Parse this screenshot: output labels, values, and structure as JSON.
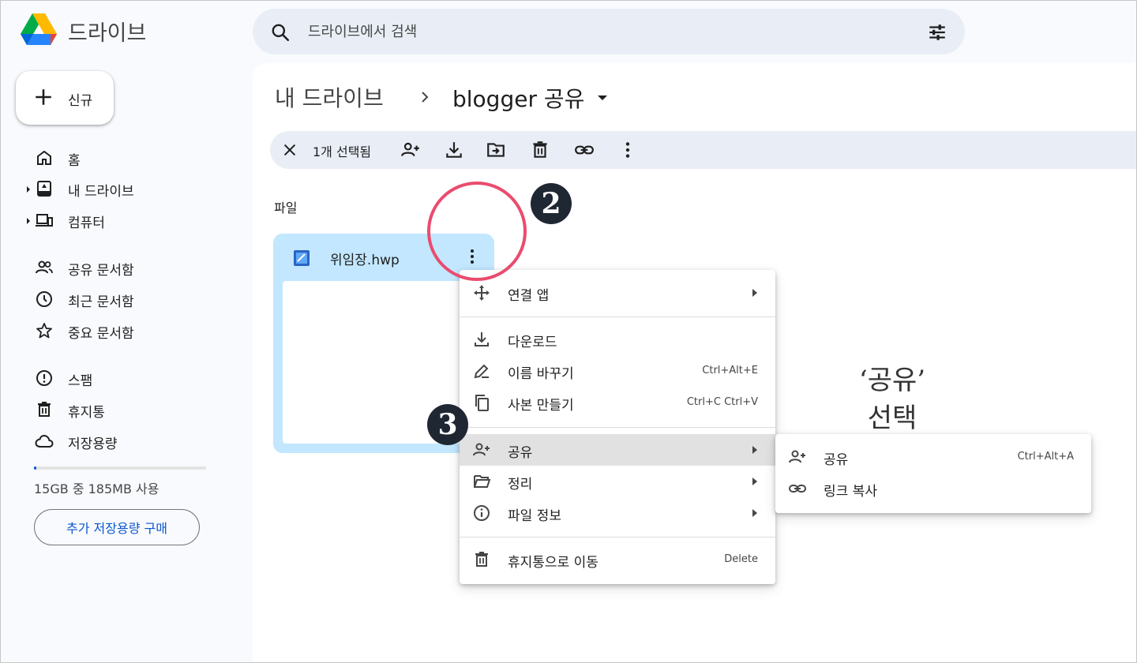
{
  "app": {
    "title": "드라이브"
  },
  "search": {
    "placeholder": "드라이브에서 검색"
  },
  "sidebar": {
    "new_label": "신규",
    "items": [
      {
        "label": "홈",
        "icon": "home-icon"
      },
      {
        "label": "내 드라이브",
        "icon": "my-drive-icon"
      },
      {
        "label": "컴퓨터",
        "icon": "computer-icon"
      },
      {
        "label": "공유 문서함",
        "icon": "shared-icon"
      },
      {
        "label": "최근 문서함",
        "icon": "clock-icon"
      },
      {
        "label": "중요 문서함",
        "icon": "star-icon"
      },
      {
        "label": "스팸",
        "icon": "spam-icon"
      },
      {
        "label": "휴지통",
        "icon": "trash-icon"
      },
      {
        "label": "저장용량",
        "icon": "cloud-icon"
      }
    ],
    "storage_text": "15GB 중 185MB 사용",
    "storage_used_fraction": 0.012,
    "buy_label": "추가 저장용량 구매"
  },
  "breadcrumb": {
    "root": "내 드라이브",
    "current": "blogger 공유"
  },
  "selection": {
    "count_label": "1개 선택됨"
  },
  "files": {
    "section_label": "파일",
    "items": [
      {
        "name": "위임장.hwp"
      }
    ]
  },
  "context_menu": {
    "items": [
      {
        "label": "연결 앱",
        "icon": "open-with-icon"
      },
      {
        "label": "다운로드",
        "icon": "download-icon"
      },
      {
        "label": "이름 바꾸기",
        "icon": "rename-icon",
        "shortcut": "Ctrl+Alt+E"
      },
      {
        "label": "사본 만들기",
        "icon": "copy-icon",
        "shortcut": "Ctrl+C Ctrl+V"
      },
      {
        "label": "공유",
        "icon": "share-icon"
      },
      {
        "label": "정리",
        "icon": "folder-open-icon"
      },
      {
        "label": "파일 정보",
        "icon": "info-icon"
      },
      {
        "label": "휴지통으로 이동",
        "icon": "trash-icon",
        "shortcut": "Delete"
      }
    ]
  },
  "share_submenu": {
    "items": [
      {
        "label": "공유",
        "icon": "person-add-icon",
        "shortcut": "Ctrl+Alt+A"
      },
      {
        "label": "링크 복사",
        "icon": "link-icon"
      }
    ]
  },
  "annotations": {
    "step2": "2",
    "step3": "3",
    "note_line1": "‘공유’",
    "note_line2": "선택"
  },
  "colors": {
    "accent": "#0b57d0",
    "selection_bg": "#c2e7ff",
    "highlight_circle": "#ea4c6e"
  }
}
